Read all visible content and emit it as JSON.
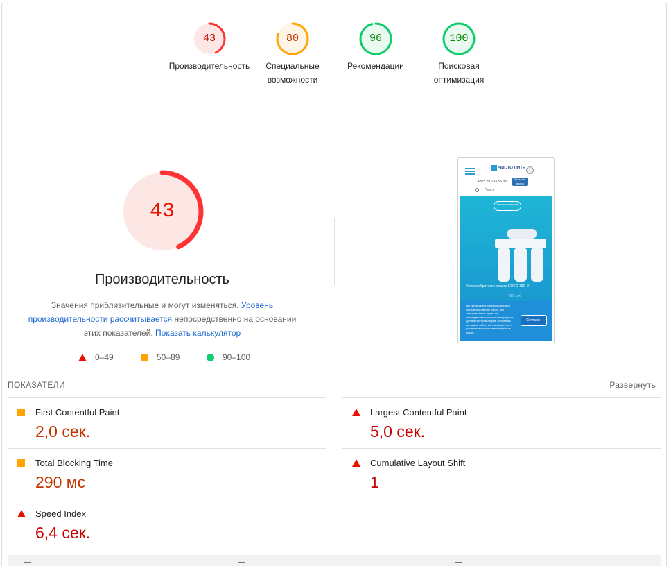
{
  "top_scores": [
    {
      "label": "Производительность",
      "value": "43",
      "fraction": 0.43,
      "color": "#ff3333",
      "bg": "#fde7e5",
      "text_color": "#c70000"
    },
    {
      "label": "Специальные возможности",
      "value": "80",
      "fraction": 0.8,
      "color": "#ffa400",
      "bg": "#fff5e6",
      "text_color": "#c33300"
    },
    {
      "label": "Рекомендации",
      "value": "96",
      "fraction": 0.96,
      "color": "#0cce6b",
      "bg": "#eafaf1",
      "text_color": "#008800"
    },
    {
      "label": "Поисковая оптимизация",
      "value": "100",
      "fraction": 1.0,
      "color": "#0cce6b",
      "bg": "#eafaf1",
      "text_color": "#008800"
    }
  ],
  "main_score": {
    "value": "43",
    "fraction": 0.43,
    "title": "Производительность",
    "desc_part1": "Значения приблизительные и могут изменяться. ",
    "desc_link1": "Уровень производительности рассчитывается",
    "desc_part2": " непосредственно на основании этих показателей. ",
    "desc_link2": "Показать калькулятор"
  },
  "legend": {
    "fail": "0–49",
    "average": "50–89",
    "pass": "90–100"
  },
  "thumbnail": {
    "logo": "ЧИСТО ПИТЬ",
    "phone": "+375 29 133 56 33",
    "call_btn": "Заказать звонок",
    "search": "Поиск",
    "hero_btn": "Каталог товаров",
    "product": "Фильтр обратного осмоса EOYC-75G-2",
    "price": "285 руб",
    "cookie_text": "Мы используем файлы cookie для улучшения работы сайта. Мы заявляем ваше право на конфиденциальность и не передаем данные третьим лицам. Оставаясь на нашем сайте, вы соглашаетесь с условиями использования файлов cookie.",
    "cookie_btn": "Согласен"
  },
  "metrics": {
    "title": "ПОКАЗАТЕЛИ",
    "expand": "Развернуть",
    "items": [
      {
        "name": "First Contentful Paint",
        "value": "2,0 сек.",
        "status": "average"
      },
      {
        "name": "Largest Contentful Paint",
        "value": "5,0 сек.",
        "status": "fail"
      },
      {
        "name": "Total Blocking Time",
        "value": "290 мс",
        "status": "average"
      },
      {
        "name": "Cumulative Layout Shift",
        "value": "1",
        "status": "fail"
      },
      {
        "name": "Speed Index",
        "value": "6,4 сек.",
        "status": "fail"
      }
    ]
  }
}
